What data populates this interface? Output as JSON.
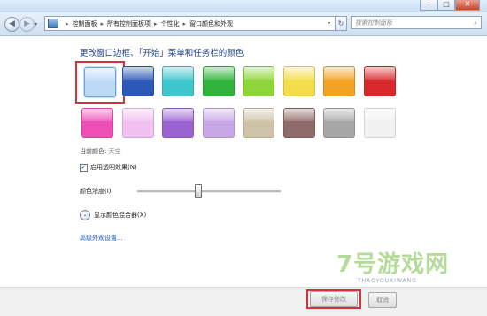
{
  "window": {
    "minimize": "–",
    "maximize": "□",
    "close": "✕"
  },
  "nav": {
    "back_icon": "back-arrow-icon",
    "forward_icon": "forward-arrow-icon",
    "dropdown_glyph": "▾",
    "breadcrumb": [
      "控制面板",
      "所有控制面板项",
      "个性化",
      "窗口颜色和外观"
    ],
    "separator": "▸",
    "refresh_glyph": "↻",
    "search_placeholder": "搜索控制面板",
    "search_icon": "magnifier-icon"
  },
  "main": {
    "heading": "更改窗口边框、「开始」菜单和任务栏的颜色",
    "swatches_row1": [
      {
        "name": "天空",
        "color": "#bcd9f6",
        "selected": true
      },
      {
        "name": "blue",
        "color": "#2d58b8",
        "selected": false
      },
      {
        "name": "teal",
        "color": "#3dc6cc",
        "selected": false
      },
      {
        "name": "green",
        "color": "#2fb33a",
        "selected": false
      },
      {
        "name": "lime",
        "color": "#8ed53b",
        "selected": false
      },
      {
        "name": "yellow",
        "color": "#f3dd4a",
        "selected": false
      },
      {
        "name": "orange",
        "color": "#f3a224",
        "selected": false
      },
      {
        "name": "red",
        "color": "#d82a2c",
        "selected": false
      }
    ],
    "swatches_row2": [
      {
        "name": "pink",
        "color": "#ee4fb6",
        "selected": false
      },
      {
        "name": "light-pink",
        "color": "#f1bff0",
        "selected": false
      },
      {
        "name": "violet",
        "color": "#9b63d1",
        "selected": false
      },
      {
        "name": "lavender",
        "color": "#c7a7e6",
        "selected": false
      },
      {
        "name": "taupe",
        "color": "#cec3a9",
        "selected": false
      },
      {
        "name": "chocolate",
        "color": "#8f6b6b",
        "selected": false
      },
      {
        "name": "slate",
        "color": "#a6a6a6",
        "selected": false
      },
      {
        "name": "frost",
        "color": "#f1f1f1",
        "selected": false
      }
    ],
    "current_label": "当前颜色:",
    "current_value": "天空",
    "transparency_label": "启用透明效果(N)",
    "transparency_checked": true,
    "intensity_label": "颜色浓度(I):",
    "intensity_level": 0.42,
    "mixer_label": "显示颜色混合器(X)",
    "mixer_glyph": "⌄",
    "advanced_link": "高级外观设置..."
  },
  "footer": {
    "save_label": "保存修改",
    "cancel_label": "取消"
  },
  "watermark": {
    "brand": "7号游戏网",
    "sub": "THAOYOUXIWANG"
  }
}
